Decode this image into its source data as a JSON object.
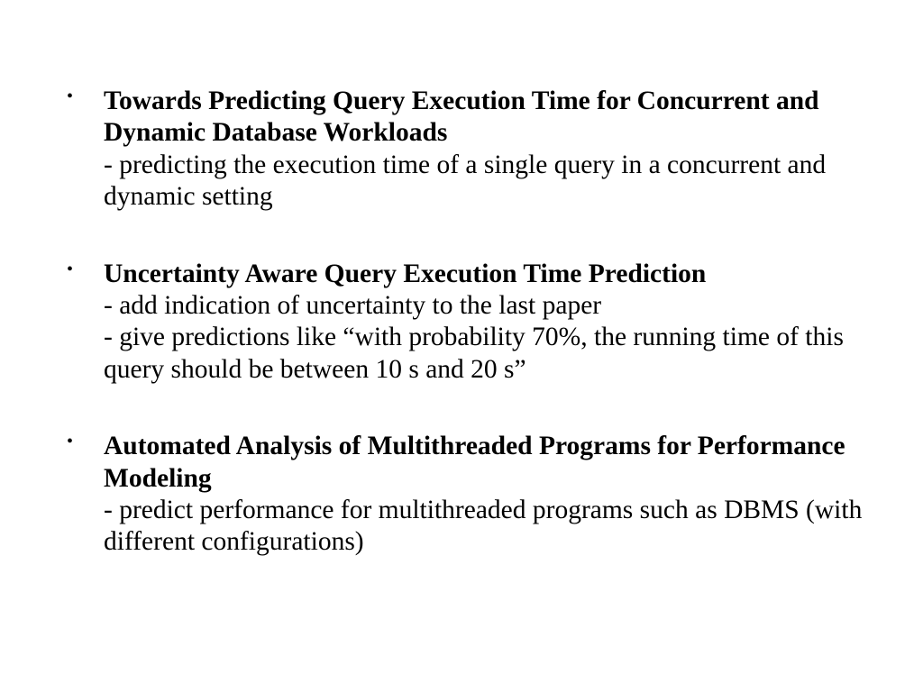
{
  "bullets": [
    {
      "title": "Towards Predicting Query Execution Time for Concurrent and Dynamic Database Workloads",
      "details": [
        "- predicting the execution time of a single query in a concurrent and dynamic setting"
      ]
    },
    {
      "title": "Uncertainty Aware Query Execution Time Prediction",
      "details": [
        "- add indication of uncertainty to the last paper",
        "- give predictions like “with probability 70%, the running time of this query should be between 10 s and 20 s”"
      ]
    },
    {
      "title": "Automated Analysis of Multithreaded Programs for Performance Modeling",
      "details": [
        "- predict performance for multithreaded programs such as DBMS (with different configurations)"
      ]
    }
  ]
}
